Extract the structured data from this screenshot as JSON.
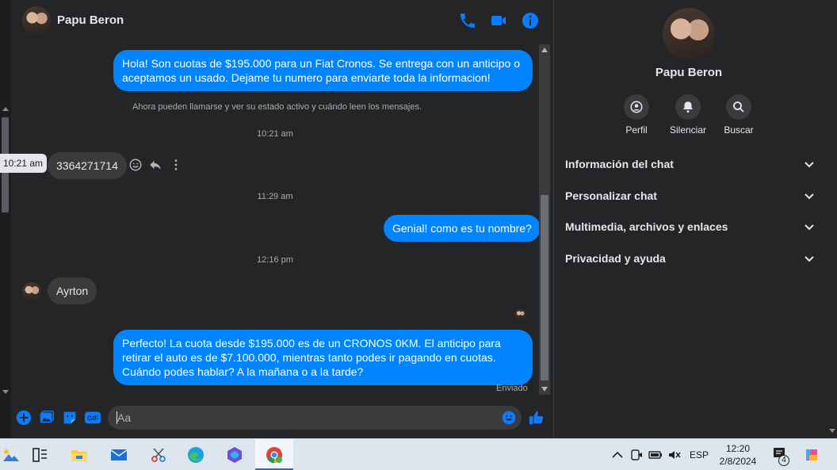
{
  "contact": {
    "name": "Papu Beron"
  },
  "messages": [
    {
      "type": "outgoing",
      "text": "Hola! Son cuotas de $195.000 para un Fiat Cronos. Se entrega con un anticipo o aceptamos un usado. Dejame tu numero para enviarte toda la informacion!"
    },
    {
      "type": "info",
      "text": "Ahora pueden llamarse y ver su estado activo y cuándo leen los mensajes."
    },
    {
      "type": "time",
      "text": "10:21 am"
    },
    {
      "type": "incoming",
      "text": "3364271714",
      "tooltip": "10:21 am"
    },
    {
      "type": "time",
      "text": "11:29 am"
    },
    {
      "type": "outgoing",
      "text": "Genial! como es tu nombre?"
    },
    {
      "type": "time",
      "text": "12:16 pm"
    },
    {
      "type": "incoming",
      "text": "Ayrton"
    },
    {
      "type": "outgoing",
      "text": "Perfecto! La cuota desde $195.000 es de un CRONOS 0KM. El anticipo para retirar el auto es de $7.100.000, mientras tanto podes ir pagando en cuotas. Cuándo podes hablar? A la mañana o a la tarde?",
      "status": "Enviado"
    }
  ],
  "composer": {
    "placeholder": "Aa",
    "gif_label": "GIF"
  },
  "right_panel": {
    "name": "Papu Beron",
    "actions": [
      {
        "label": "Perfil",
        "icon": "profile-icon"
      },
      {
        "label": "Silenciar",
        "icon": "bell-icon"
      },
      {
        "label": "Buscar",
        "icon": "search-icon"
      }
    ],
    "sections": [
      {
        "label": "Información del chat"
      },
      {
        "label": "Personalizar chat"
      },
      {
        "label": "Multimedia, archivos y enlaces"
      },
      {
        "label": "Privacidad y ayuda"
      }
    ]
  },
  "taskbar": {
    "apps": [
      "weather-icon",
      "task-view-icon",
      "file-explorer-icon",
      "mail-icon",
      "snipping-tool-icon",
      "edge-icon",
      "copilot-icon",
      "chrome-icon"
    ],
    "language": "ESP",
    "time": "12:20",
    "date": "2/8/2024",
    "notification_count": "4",
    "colors": {
      "accent": "#0084ff",
      "taskbar": "#dde6ef"
    }
  }
}
